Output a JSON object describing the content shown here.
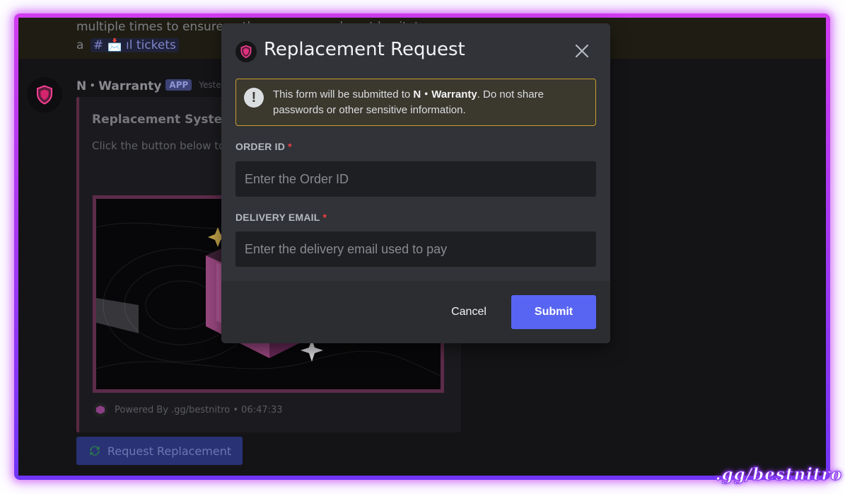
{
  "colors": {
    "frame_top": "#d23cf0",
    "frame_bottom": "#6f35f6",
    "modal_bg": "#313338",
    "accent": "#5865f2",
    "warning_border": "#c79d2e",
    "required": "#f23f43"
  },
  "background": {
    "notice_line1": "multiple times to ensure ... there was one, do not hesitate, open",
    "notice_line2_prefix": "a",
    "channel_chip": "# 📩 ıl tickets",
    "author": "N・Warranty",
    "app_badge": "APP",
    "timestamp": "Yeste",
    "embed_title": "Replacement System",
    "embed_desc": "Click the button below to",
    "footer_text": "Powered By .gg/bestnitro • 06:47:33",
    "request_button_label": "Request Replacement",
    "request_button_icon": "refresh-icon"
  },
  "modal": {
    "title": "Replacement Request",
    "icon": "shield-icon",
    "close_icon": "close-icon",
    "warning": {
      "icon": "exclamation-icon",
      "text_before": "This form will be submitted to ",
      "bold_name": "N・Warranty",
      "text_after": ". Do not share passwords or other sensitive information."
    },
    "fields": [
      {
        "label": "ORDER ID",
        "required_mark": "*",
        "placeholder": "Enter the Order ID",
        "value": ""
      },
      {
        "label": "DELIVERY EMAIL",
        "required_mark": "*",
        "placeholder": "Enter the delivery email used to pay",
        "value": ""
      }
    ],
    "cancel_label": "Cancel",
    "submit_label": "Submit"
  },
  "watermark": ".gg/bestnitro"
}
